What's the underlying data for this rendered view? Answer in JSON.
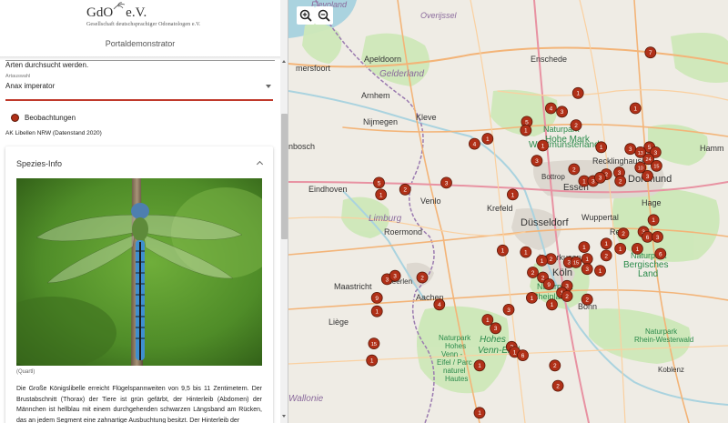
{
  "header": {
    "logo_text": "GdO",
    "logo_suffix": "e.V.",
    "logo_subtitle": "Gesellschaft deutschsprachiger Odonatologen e.V.",
    "app_title": "Portaldemonstrator"
  },
  "sidebar": {
    "hint_text": "Arten durchsucht werden.",
    "select_label": "Artauswahl",
    "select_value": "Anax imperator",
    "legend_label": "Beobachtungen",
    "source_text": "AK Libellen NRW (Datenstand 2020)",
    "card_title": "Spezies-Info",
    "photo_caption": "(Quartl)",
    "description": "Die Große Königslibelle erreicht Flügelspannweiten von 9,5 bis 11 Zentimetern. Der Brustabschnitt (Thorax) der Tiere ist grün gefärbt, der Hinterleib (Abdomen) der Männchen ist hellblau mit einem durchgehenden schwarzen Längsband am Rücken, das an jedem Segment eine zahnartige Ausbuchtung besitzt. Der Hinterleib der"
  },
  "colors": {
    "accent": "#c0392b",
    "marker": "#b03018",
    "forest": "#2a8a4a"
  },
  "map": {
    "zoom_in_icon": "zoom-in-icon",
    "zoom_out_icon": "zoom-out-icon",
    "labels": {
      "flevoland": "Flevoland",
      "overijssel": "Overijssel",
      "enschede": "Enschede",
      "apeldoorn": "Apeldoorn",
      "amersfoort": "mersfoort",
      "gelderland": "Gelderland",
      "arnhem": "Arnhem",
      "nijmegen": "Nijmegen",
      "kleve": "Kleve",
      "hohe_mark_1": "Naturpark",
      "hohe_mark_2": "Hohe Mark",
      "hohe_mark_3": "Westmünsterland",
      "hamm": "Hamm",
      "recklinghausen": "Recklinghausen",
      "bottrop": "Bottrop",
      "dortmund": "Dortmund",
      "essen": "Essen",
      "bosch": "nbosch",
      "eindhoven": "Eindhoven",
      "venlo": "Venlo",
      "krefeld": "Krefeld",
      "limburg": "Limburg",
      "roermond": "Roermond",
      "duesseldorf": "Düsseldorf",
      "wuppertal": "Wuppertal",
      "hagen": "Hage",
      "remscheid": "Rem",
      "leverkusen": "Leverkusen",
      "bergisch_1": "Naturpark",
      "bergisch_2": "Bergisches",
      "bergisch_3": "Land",
      "koeln": "Köln",
      "rheinland_1": "Naturpark",
      "rheinland_2": "Rheinland",
      "maastricht": "Maastricht",
      "heerlen": "Heerlen",
      "aachen": "Aachen",
      "bonn": "Bonn",
      "liege": "Liège",
      "venn_1": "Hohes",
      "venn_2": "Venn-Eifel",
      "eifel_1": "Naturpark",
      "eifel_2": "Hohes",
      "eifel_3": "Venn -",
      "eifel_4": "Eifel / Parc",
      "eifel_5": "naturel",
      "eifel_6": "Hautes",
      "rhein_westerwald_1": "Naturpark",
      "rhein_westerwald_2": "Rhein-Westerwald",
      "koblenz": "Koblenz",
      "wallonie": "Wallonie"
    },
    "markers": [
      {
        "label": "7",
        "lat": 52.66,
        "lon": 8.6
      },
      {
        "label": "1",
        "lat": 52.42,
        "lon": 7.88
      },
      {
        "label": "4",
        "lat": 52.33,
        "lon": 7.61
      },
      {
        "label": "3",
        "lat": 52.31,
        "lon": 7.72
      },
      {
        "label": "1",
        "lat": 52.33,
        "lon": 8.45
      },
      {
        "label": "5",
        "lat": 52.25,
        "lon": 7.37
      },
      {
        "label": "1",
        "lat": 52.2,
        "lon": 7.36
      },
      {
        "label": "2",
        "lat": 52.23,
        "lon": 7.86
      },
      {
        "label": "1",
        "lat": 52.15,
        "lon": 6.98
      },
      {
        "label": "4",
        "lat": 52.12,
        "lon": 6.85
      },
      {
        "label": "1",
        "lat": 52.11,
        "lon": 7.53
      },
      {
        "label": "1",
        "lat": 52.1,
        "lon": 8.11
      },
      {
        "label": "3",
        "lat": 52.09,
        "lon": 8.4
      },
      {
        "label": "5",
        "lat": 52.1,
        "lon": 8.59
      },
      {
        "label": "13",
        "lat": 52.07,
        "lon": 8.5
      },
      {
        "label": "3",
        "lat": 52.07,
        "lon": 8.65
      },
      {
        "label": "3",
        "lat": 52.02,
        "lon": 7.47
      },
      {
        "label": "24",
        "lat": 52.03,
        "lon": 8.58
      },
      {
        "label": "15",
        "lat": 51.99,
        "lon": 8.66
      },
      {
        "label": "2",
        "lat": 51.97,
        "lon": 7.84
      },
      {
        "label": "10",
        "lat": 51.98,
        "lon": 8.5
      },
      {
        "label": "3",
        "lat": 51.95,
        "lon": 8.29
      },
      {
        "label": "2",
        "lat": 51.94,
        "lon": 8.16
      },
      {
        "label": "3",
        "lat": 51.93,
        "lon": 8.57
      },
      {
        "label": "1",
        "lat": 51.9,
        "lon": 7.94
      },
      {
        "label": "3",
        "lat": 51.9,
        "lon": 8.03
      },
      {
        "label": "3",
        "lat": 51.92,
        "lon": 8.1
      },
      {
        "label": "2",
        "lat": 51.9,
        "lon": 8.3
      },
      {
        "label": "3",
        "lat": 51.89,
        "lon": 6.57
      },
      {
        "label": "5",
        "lat": 51.89,
        "lon": 5.9
      },
      {
        "label": "2",
        "lat": 51.85,
        "lon": 6.16
      },
      {
        "label": "1",
        "lat": 51.82,
        "lon": 7.23
      },
      {
        "label": "1",
        "lat": 51.82,
        "lon": 5.92
      },
      {
        "label": "1",
        "lat": 51.67,
        "lon": 8.63
      },
      {
        "label": "3",
        "lat": 51.6,
        "lon": 8.53
      },
      {
        "label": "2",
        "lat": 51.59,
        "lon": 8.33
      },
      {
        "label": "6",
        "lat": 51.57,
        "lon": 8.57
      },
      {
        "label": "3",
        "lat": 51.57,
        "lon": 8.67
      },
      {
        "label": "1",
        "lat": 51.53,
        "lon": 8.16
      },
      {
        "label": "1",
        "lat": 51.51,
        "lon": 7.94
      },
      {
        "label": "1",
        "lat": 51.5,
        "lon": 8.3
      },
      {
        "label": "1",
        "lat": 51.5,
        "lon": 8.47
      },
      {
        "label": "1",
        "lat": 51.49,
        "lon": 7.13
      },
      {
        "label": "1",
        "lat": 51.48,
        "lon": 7.36
      },
      {
        "label": "6",
        "lat": 51.47,
        "lon": 8.7
      },
      {
        "label": "2",
        "lat": 51.46,
        "lon": 8.16
      },
      {
        "label": "2",
        "lat": 51.44,
        "lon": 7.61
      },
      {
        "label": "1",
        "lat": 51.43,
        "lon": 7.52
      },
      {
        "label": "3",
        "lat": 51.42,
        "lon": 7.79
      },
      {
        "label": "15",
        "lat": 51.42,
        "lon": 7.86
      },
      {
        "label": "1",
        "lat": 51.44,
        "lon": 7.97
      },
      {
        "label": "3",
        "lat": 51.38,
        "lon": 7.97
      },
      {
        "label": "1",
        "lat": 51.37,
        "lon": 8.1
      },
      {
        "label": "2",
        "lat": 51.36,
        "lon": 7.43
      },
      {
        "label": "3",
        "lat": 51.32,
        "lon": 5.98
      },
      {
        "label": "3",
        "lat": 51.34,
        "lon": 6.06
      },
      {
        "label": "2",
        "lat": 51.33,
        "lon": 6.33
      },
      {
        "label": "2",
        "lat": 51.33,
        "lon": 7.53
      },
      {
        "label": "9",
        "lat": 51.29,
        "lon": 7.59
      },
      {
        "label": "3",
        "lat": 51.28,
        "lon": 7.77
      },
      {
        "label": "1",
        "lat": 51.24,
        "lon": 7.72
      },
      {
        "label": "9",
        "lat": 51.21,
        "lon": 5.88
      },
      {
        "label": "1",
        "lat": 51.21,
        "lon": 7.42
      },
      {
        "label": "2",
        "lat": 51.22,
        "lon": 7.77
      },
      {
        "label": "2",
        "lat": 51.2,
        "lon": 7.97
      },
      {
        "label": "4",
        "lat": 51.17,
        "lon": 6.5
      },
      {
        "label": "1",
        "lat": 51.17,
        "lon": 7.62
      },
      {
        "label": "3",
        "lat": 51.14,
        "lon": 7.19
      },
      {
        "label": "1",
        "lat": 51.13,
        "lon": 5.88
      },
      {
        "label": "1",
        "lat": 51.08,
        "lon": 6.98
      },
      {
        "label": "3",
        "lat": 51.03,
        "lon": 7.06
      },
      {
        "label": "15",
        "lat": 50.94,
        "lon": 5.85
      },
      {
        "label": "2",
        "lat": 50.92,
        "lon": 7.22
      },
      {
        "label": "1",
        "lat": 50.89,
        "lon": 7.25
      },
      {
        "label": "6",
        "lat": 50.87,
        "lon": 7.33
      },
      {
        "label": "1",
        "lat": 50.84,
        "lon": 5.83
      },
      {
        "label": "1",
        "lat": 50.81,
        "lon": 6.9
      },
      {
        "label": "2",
        "lat": 50.81,
        "lon": 7.65
      },
      {
        "label": "2",
        "lat": 50.69,
        "lon": 7.68
      },
      {
        "label": "1",
        "lat": 50.53,
        "lon": 6.9
      }
    ]
  }
}
